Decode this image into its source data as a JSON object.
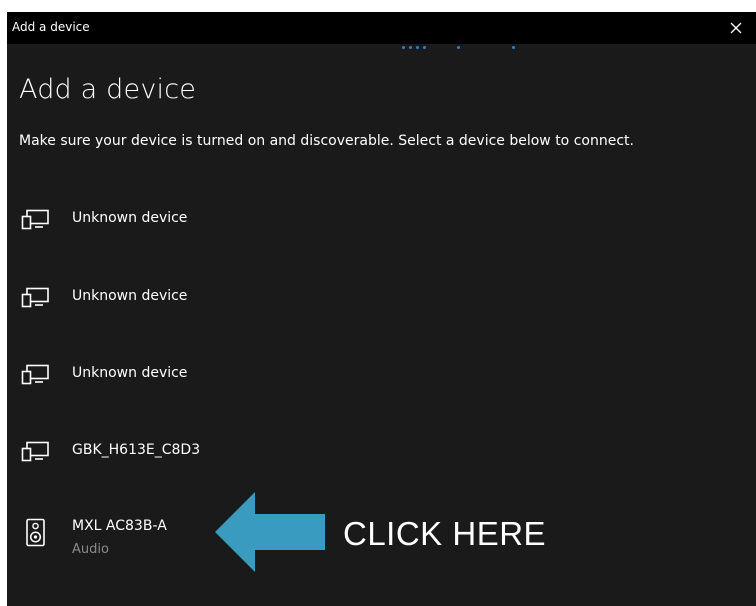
{
  "window": {
    "title": "Add a device",
    "close_icon": "close-icon"
  },
  "main": {
    "heading": "Add a device",
    "instructions": "Make sure your device is turned on and discoverable. Select a device below to connect."
  },
  "devices": [
    {
      "name": "Unknown device",
      "subtitle": "",
      "icon": "display-device-icon"
    },
    {
      "name": "Unknown device",
      "subtitle": "",
      "icon": "display-device-icon"
    },
    {
      "name": "Unknown device",
      "subtitle": "",
      "icon": "display-device-icon"
    },
    {
      "name": "GBK_H613E_C8D3",
      "subtitle": "",
      "icon": "display-device-icon"
    },
    {
      "name": "MXL AC83B-A",
      "subtitle": "Audio",
      "icon": "speaker-icon"
    }
  ],
  "annotation": {
    "label": "CLICK HERE",
    "arrow_color": "#3a9bc0",
    "arrow_icon": "arrow-left-icon"
  },
  "colors": {
    "window_bg": "#1a1a1a",
    "titlebar_bg": "#000000",
    "progress_accent": "#2a7fd4",
    "subtitle_text": "#8a8a8a"
  }
}
